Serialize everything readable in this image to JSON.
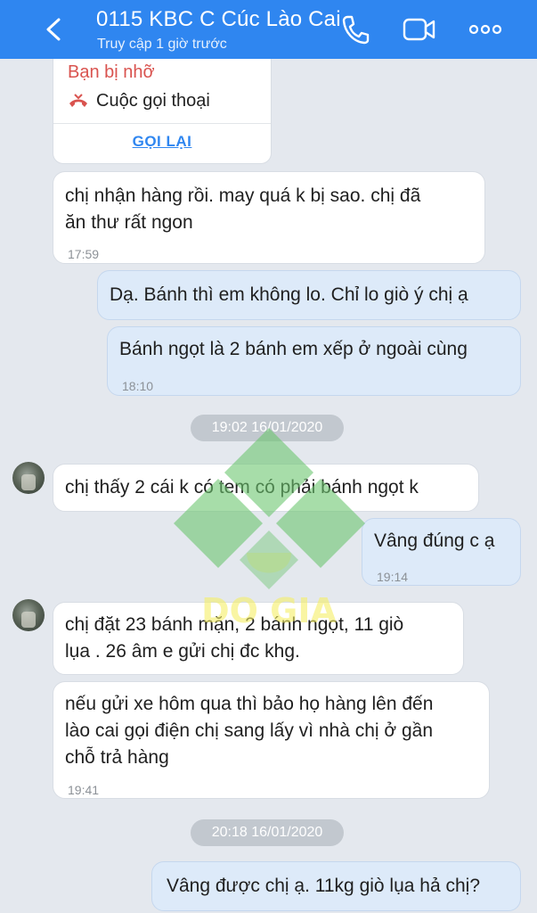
{
  "header": {
    "title": "0115 KBC C Cúc Lào Cai",
    "subtitle": "Truy cập 1 giờ trước",
    "icons": [
      "back-icon",
      "phone-icon",
      "video-call-icon",
      "more-icon"
    ],
    "color": "#2f86f0"
  },
  "missed_call": {
    "title": "Bạn bị nhỡ",
    "label": "Cuộc gọi thoại",
    "action": "GỌI LẠI"
  },
  "messages": [
    {
      "lines": [
        "chị nhận hàng rồi. may quá k bị  sao. chị đã",
        "ăn thư rất ngon"
      ],
      "time": "17:59",
      "side": "in"
    },
    {
      "lines": [
        "Dạ. Bánh thì em không lo. Chỉ lo giò ý chị ạ"
      ],
      "time": "",
      "side": "out"
    },
    {
      "lines": [
        "Bánh ngọt là 2 bánh em xếp ở ngoài cùng"
      ],
      "time": "18:10",
      "side": "out"
    },
    {
      "lines": [
        "chị thấy 2 cái k có tem có phải bánh ngọt k"
      ],
      "time": "",
      "side": "in"
    },
    {
      "lines": [
        "Vâng đúng c ạ"
      ],
      "time": "19:14",
      "side": "out"
    },
    {
      "lines": [
        "chị đặt 23 bánh mặn, 2 bánh ngọt, 11 giò",
        "lụa . 26 âm e gửi chị đc khg."
      ],
      "time": "",
      "side": "in"
    },
    {
      "lines": [
        "nếu gửi xe hôm qua thì bảo họ hàng lên đến",
        "lào cai gọi điện chị sang lấy vì nhà chị ở gần",
        "chỗ trả hàng"
      ],
      "time": "19:41",
      "side": "in"
    },
    {
      "lines": [
        "Vâng được chị ạ. 11kg giò lụa hả chị?"
      ],
      "time": "",
      "side": "out"
    }
  ],
  "dates": [
    "19:02 16/01/2020",
    "20:18 16/01/2020"
  ],
  "watermark": {
    "text": "DO GIA"
  }
}
